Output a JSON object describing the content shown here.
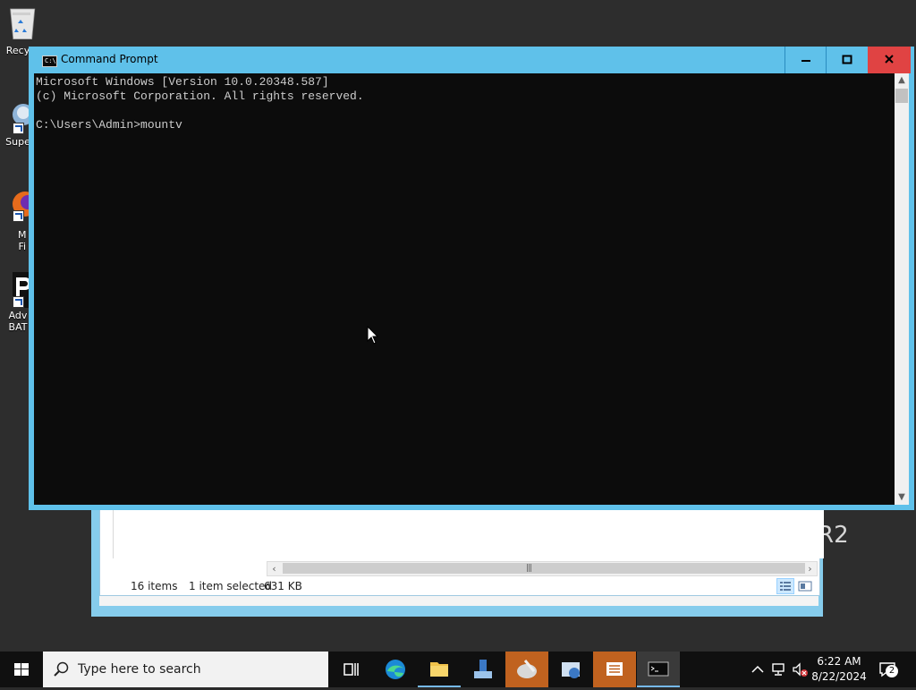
{
  "desktop": {
    "icons": [
      {
        "label": "Recy",
        "name": "recycle-bin"
      },
      {
        "label": "Supe",
        "name": "super-shortcut"
      },
      {
        "label": "M\nFi",
        "name": "firefox-shortcut"
      },
      {
        "label": "Adv\nBAT",
        "name": "advanced-bat-shortcut"
      }
    ],
    "wallpaper_text": "R2"
  },
  "explorer": {
    "status_items": "16 items",
    "status_selected": "1 item selected",
    "status_size": "631 KB"
  },
  "cmd": {
    "title": "Command Prompt",
    "icon_text": "C:\\",
    "lines": [
      "Microsoft Windows [Version 10.0.20348.587]",
      "(c) Microsoft Corporation. All rights reserved.",
      "",
      "C:\\Users\\Admin>mountv"
    ]
  },
  "taskbar": {
    "search_placeholder": "Type here to search",
    "time": "6:22 AM",
    "date": "8/22/2024",
    "notification_count": "2"
  },
  "colors": {
    "window_frame": "#5fc1ea",
    "close_button": "#e04343",
    "console_bg": "#0c0c0c",
    "console_text": "#cccccc",
    "taskbar_bg": "#101010"
  }
}
